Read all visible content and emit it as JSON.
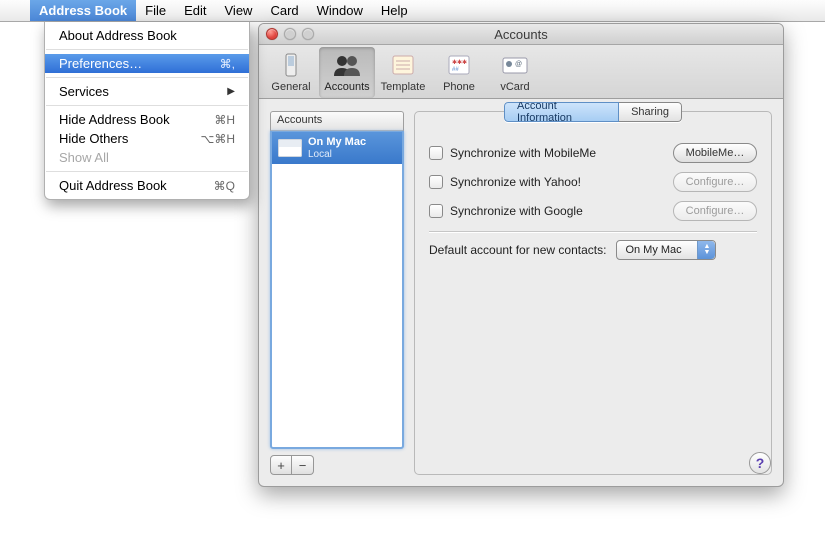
{
  "menubar": {
    "app": "Address Book",
    "items": [
      "File",
      "Edit",
      "View",
      "Card",
      "Window",
      "Help"
    ]
  },
  "app_menu": {
    "about": "About Address Book",
    "preferences": "Preferences…",
    "preferences_shortcut": "⌘,",
    "services": "Services",
    "hide_app": "Hide Address Book",
    "hide_app_shortcut": "⌘H",
    "hide_others": "Hide Others",
    "hide_others_shortcut": "⌥⌘H",
    "show_all": "Show All",
    "quit": "Quit Address Book",
    "quit_shortcut": "⌘Q"
  },
  "window": {
    "title": "Accounts",
    "toolbar": {
      "general": "General",
      "accounts": "Accounts",
      "template": "Template",
      "phone": "Phone",
      "vcard": "vCard"
    },
    "accounts_header": "Accounts",
    "account_item": {
      "name": "On My Mac",
      "sub": "Local"
    },
    "tabs": {
      "info": "Account Information",
      "sharing": "Sharing"
    },
    "sync": {
      "mobileme_label": "Synchronize with MobileMe",
      "mobileme_btn": "MobileMe…",
      "yahoo_label": "Synchronize with Yahoo!",
      "yahoo_btn": "Configure…",
      "google_label": "Synchronize with Google",
      "google_btn": "Configure…"
    },
    "default_label": "Default account for new contacts:",
    "default_value": "On My Mac",
    "help": "?"
  }
}
